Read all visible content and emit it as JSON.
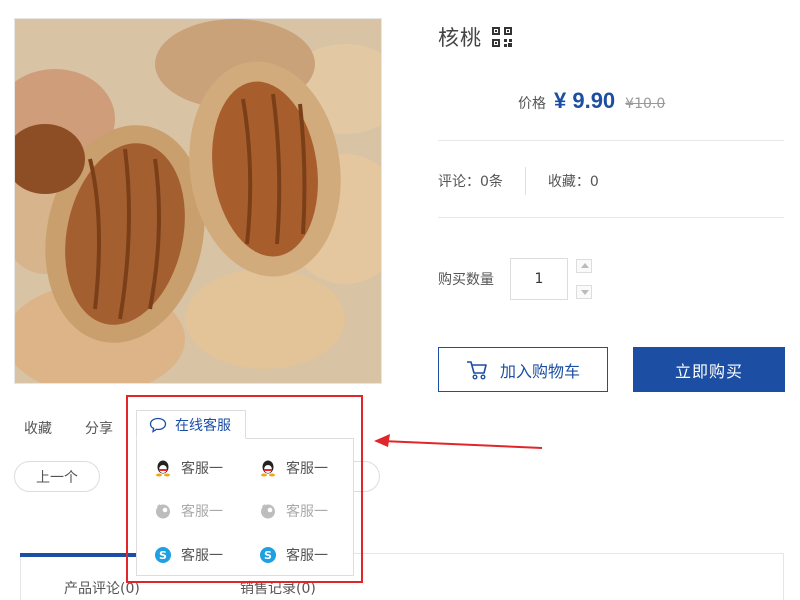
{
  "product": {
    "title": "核桃",
    "qr_icon": "qr-code-icon",
    "image_alt": "pecan nuts photo"
  },
  "price": {
    "label": "价格",
    "current": "¥ 9.90",
    "original": "¥10.0"
  },
  "stats": {
    "reviews": "评论：0条",
    "favorites": "收藏：0"
  },
  "quantity": {
    "label": "购买数量",
    "value": "1"
  },
  "buttons": {
    "add_to_cart": "加入购物车",
    "buy_now": "立即购买",
    "prev": "上一个"
  },
  "actions": {
    "favorite": "收藏",
    "share": "分享",
    "online_service": "在线客服"
  },
  "service_list": [
    {
      "label": "客服一",
      "icon": "qq-icon",
      "enabled": true
    },
    {
      "label": "客服一",
      "icon": "qq-icon",
      "enabled": true
    },
    {
      "label": "客服一",
      "icon": "wangwang-icon",
      "enabled": false
    },
    {
      "label": "客服一",
      "icon": "wangwang-icon",
      "enabled": false
    },
    {
      "label": "客服一",
      "icon": "skype-icon",
      "enabled": true
    },
    {
      "label": "客服一",
      "icon": "skype-icon",
      "enabled": true
    }
  ],
  "tabs": {
    "reviews": "产品评论(0)",
    "sales": "销售记录(0)"
  },
  "colors": {
    "accent": "#1c4fa3",
    "annotation": "#e1262a"
  }
}
